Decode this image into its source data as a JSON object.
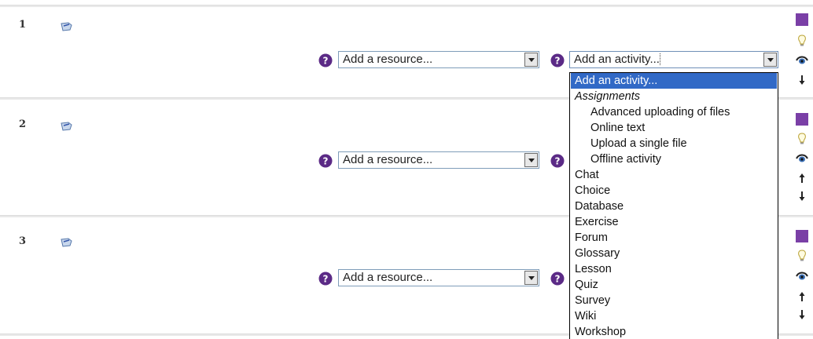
{
  "topics": [
    {
      "number": "1",
      "resource_placeholder": "Add a resource...",
      "activity_placeholder": "Add an activity..."
    },
    {
      "number": "2",
      "resource_placeholder": "Add a resource..."
    },
    {
      "number": "3",
      "resource_placeholder": "Add a resource..."
    }
  ],
  "activity_dropdown": {
    "options": [
      {
        "label": "Add an activity...",
        "kind": "selected"
      },
      {
        "label": "Assignments",
        "kind": "group"
      },
      {
        "label": "Advanced uploading of files",
        "kind": "sub"
      },
      {
        "label": "Online text",
        "kind": "sub"
      },
      {
        "label": "Upload a single file",
        "kind": "sub"
      },
      {
        "label": "Offline activity",
        "kind": "sub"
      },
      {
        "label": "Chat",
        "kind": "item"
      },
      {
        "label": "Choice",
        "kind": "item"
      },
      {
        "label": "Database",
        "kind": "item"
      },
      {
        "label": "Exercise",
        "kind": "item"
      },
      {
        "label": "Forum",
        "kind": "item"
      },
      {
        "label": "Glossary",
        "kind": "item"
      },
      {
        "label": "Lesson",
        "kind": "item"
      },
      {
        "label": "Quiz",
        "kind": "item"
      },
      {
        "label": "Survey",
        "kind": "item"
      },
      {
        "label": "Wiki",
        "kind": "item"
      },
      {
        "label": "Workshop",
        "kind": "item"
      }
    ]
  },
  "icons": {
    "help": "help-icon",
    "edit": "edit-summary-icon",
    "highlight": "lightbulb-icon",
    "visibility": "eye-icon",
    "move_up": "arrow-up-icon",
    "move_down": "arrow-down-icon",
    "marker": "purple-square-icon"
  },
  "colors": {
    "accent_purple": "#7a3fa6",
    "help_icon": "#5b2a86",
    "selection_blue": "#3169c6"
  }
}
